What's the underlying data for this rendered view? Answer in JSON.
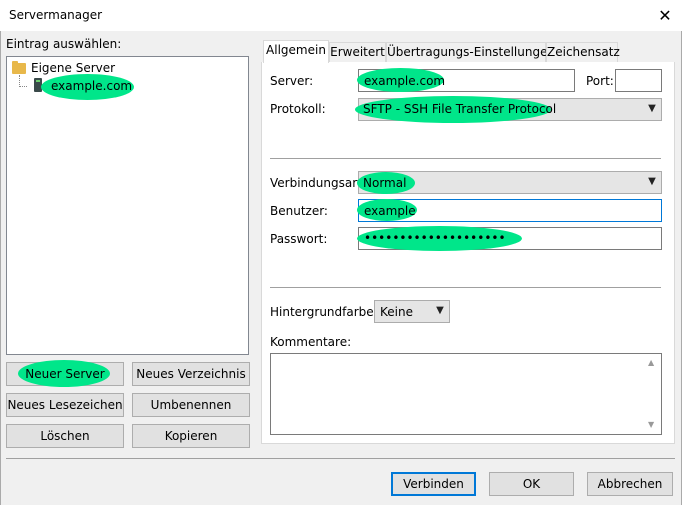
{
  "window": {
    "title": "Servermanager",
    "close_glyph": "✕"
  },
  "left": {
    "select_label": "Eintrag auswählen:",
    "tree": {
      "root_label": "Eigene Server",
      "child_label": "example.com"
    },
    "buttons": {
      "new_server": "Neuer Server",
      "new_folder": "Neues Verzeichnis",
      "new_bookmark": "Neues Lesezeichen",
      "rename": "Umbenennen",
      "delete": "Löschen",
      "copy": "Kopieren"
    }
  },
  "tabs": [
    "Allgemein",
    "Erweitert",
    "Übertragungs-Einstellungen",
    "Zeichensatz"
  ],
  "general": {
    "server_label": "Server:",
    "server_value": "example.com",
    "port_label": "Port:",
    "port_value": "",
    "protocol_label": "Protokoll:",
    "protocol_value": "SFTP - SSH File Transfer Protocol",
    "logontype_label": "Verbindungsart:",
    "logontype_value": "Normal",
    "user_label": "Benutzer:",
    "user_value": "example",
    "password_label": "Passwort:",
    "password_value": "••••••••••••••••••••",
    "bgcolor_label": "Hintergrundfarbe:",
    "bgcolor_value": "Keine",
    "comments_label": "Kommentare:",
    "comments_value": ""
  },
  "footer": {
    "connect": "Verbinden",
    "ok": "OK",
    "cancel": "Abbrechen"
  },
  "colors": {
    "highlight": "#00e68a",
    "focus": "#0078d7",
    "folder": "#e8b84a"
  },
  "icons": {
    "folder": "folder-icon",
    "server": "server-icon",
    "dropdown": "chevron-down-icon",
    "close": "close-icon"
  }
}
